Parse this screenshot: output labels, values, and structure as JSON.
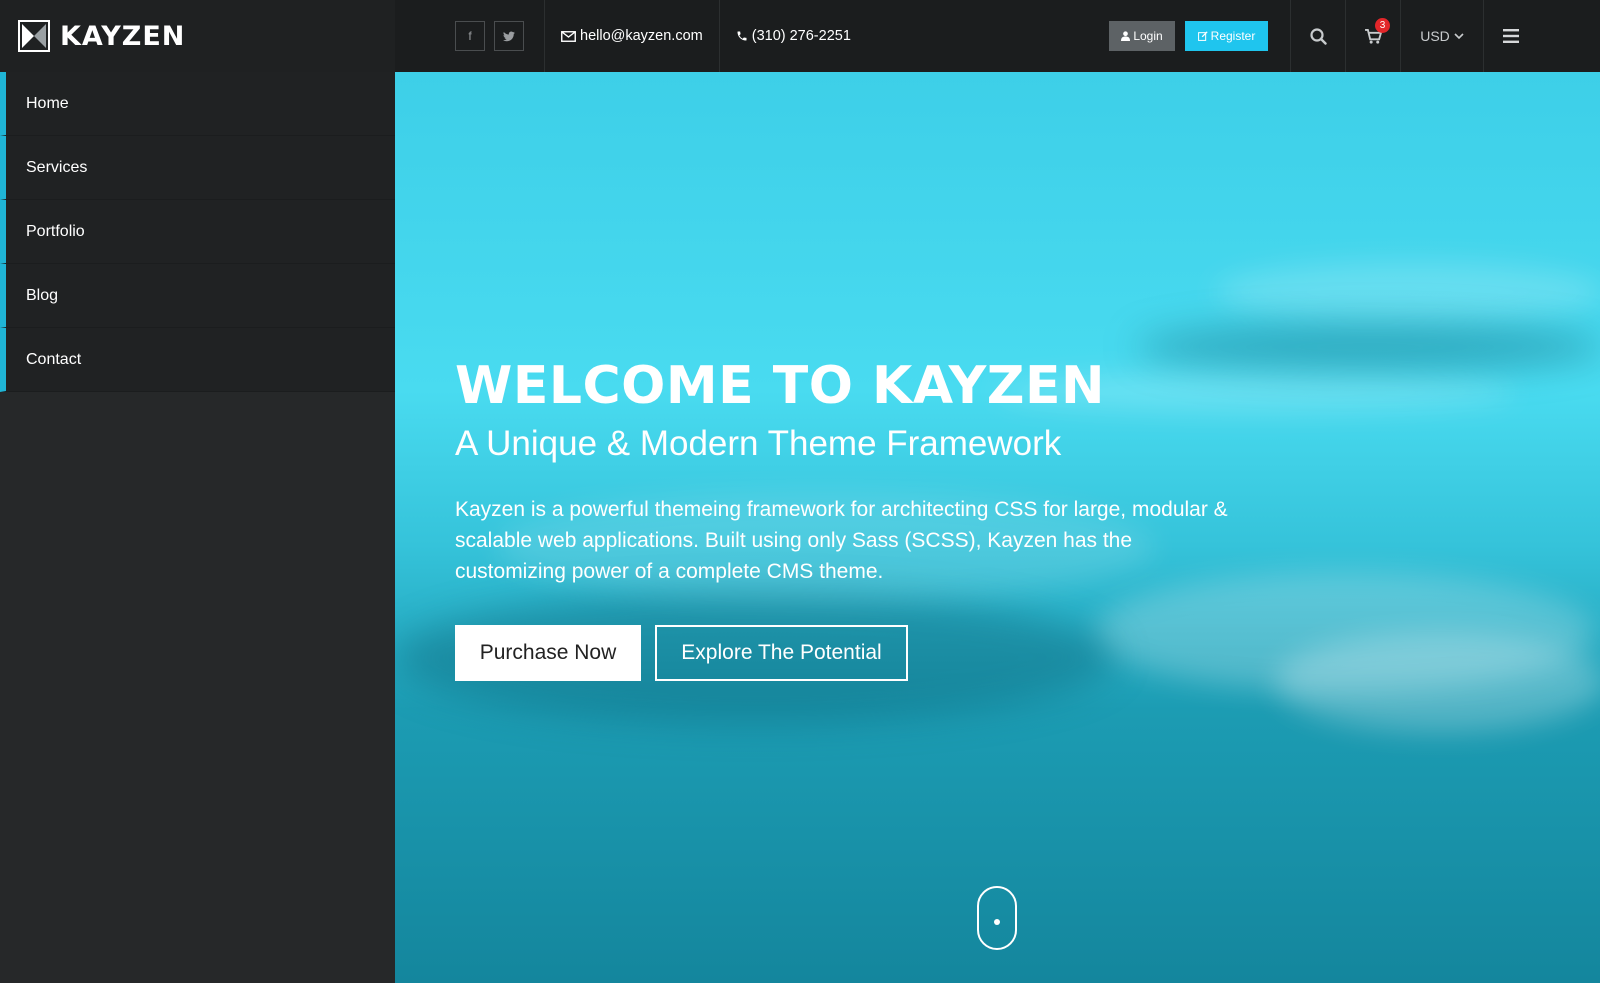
{
  "brand": {
    "name": "KAYZEN"
  },
  "sidebar": {
    "items": [
      {
        "label": "Home"
      },
      {
        "label": "Services"
      },
      {
        "label": "Portfolio"
      },
      {
        "label": "Blog"
      },
      {
        "label": "Contact"
      }
    ]
  },
  "topbar": {
    "social": [
      {
        "icon": "facebook-icon",
        "glyph": "f"
      },
      {
        "icon": "twitter-icon",
        "glyph": "t"
      }
    ],
    "email": "hello@kayzen.com",
    "phone": "(310) 276-2251",
    "login_label": "Login",
    "register_label": "Register",
    "cart_count": "3",
    "currency": "USD"
  },
  "hero": {
    "title": "WELCOME TO KAYZEN",
    "subtitle": "A Unique & Modern Theme Framework",
    "description": "Kayzen is a powerful themeing framework for architecting CSS for large, modular & scalable web applications. Built using only Sass (SCSS), Kayzen has the customizing power of a complete CMS theme.",
    "purchase_label": "Purchase Now",
    "explore_label": "Explore The Potential"
  },
  "colors": {
    "accent": "#1fc5ee",
    "sidebar_bg": "#262829",
    "topbar_bg": "#1b1d1e",
    "badge": "#e2262a"
  }
}
